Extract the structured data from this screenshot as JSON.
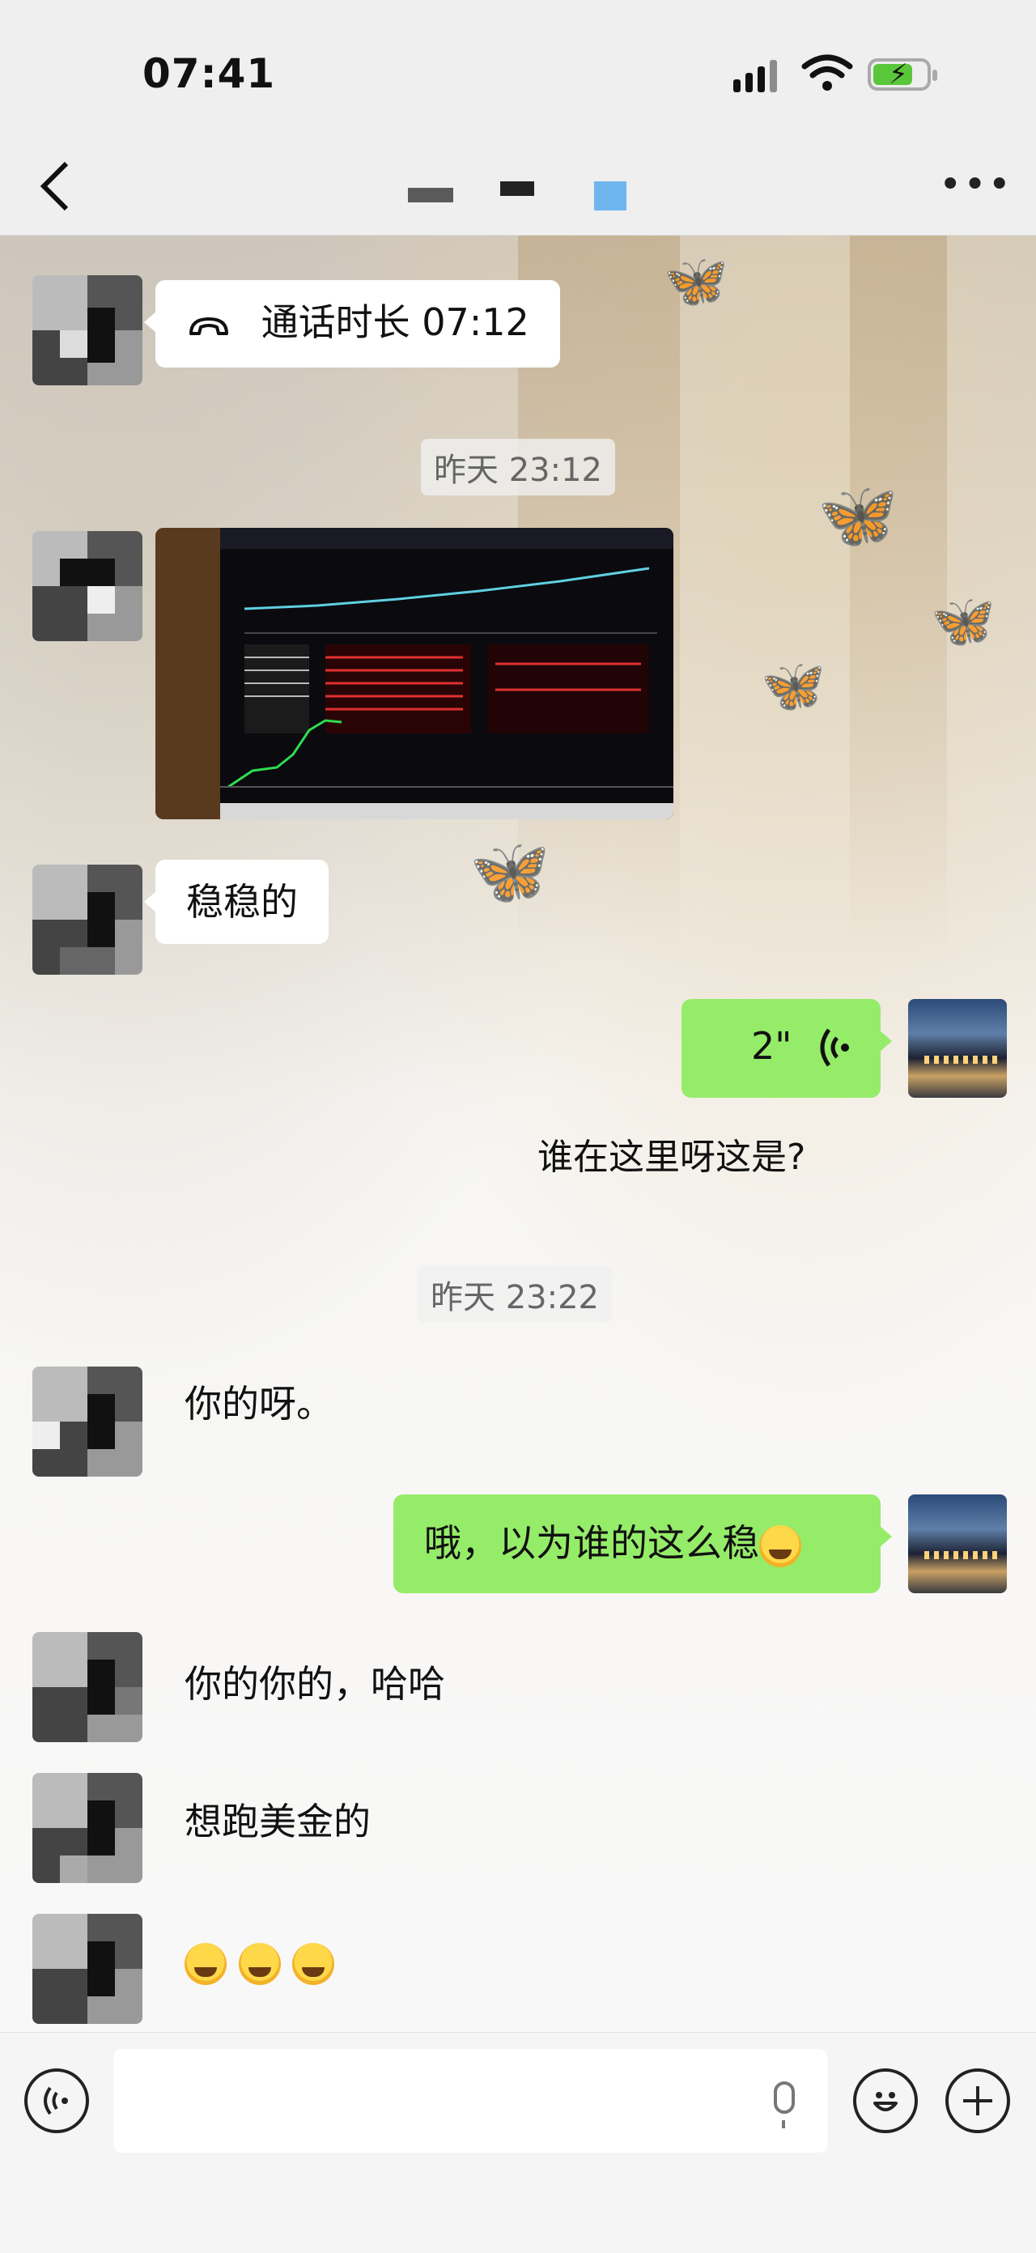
{
  "status_bar": {
    "time": "07:41"
  },
  "header": {
    "back_icon": "chevron-left-icon",
    "more_label": "•••"
  },
  "messages": {
    "call": {
      "label": "通话时长 07:12",
      "icon": "phone-hangup-icon"
    },
    "stamp1": "昨天 23:12",
    "photo": {
      "type": "trading-platform-screenshot"
    },
    "msg_wenwen": "稳稳的",
    "voice": {
      "duration": "2\"",
      "icon": "voice-wave-icon"
    },
    "transcript": "谁在这里呀这是?",
    "stamp2": "昨天 23:22",
    "msg_nide": "你的呀。",
    "msg_reply": "哦，以为谁的这么稳",
    "msg_haha": "你的你的，哈哈",
    "msg_usd": "想跑美金的",
    "msg_emoji_count": 3
  },
  "input_bar": {
    "placeholder": ""
  },
  "colors": {
    "accent_green": "#95ec69",
    "battery_green": "#5ac73b"
  }
}
